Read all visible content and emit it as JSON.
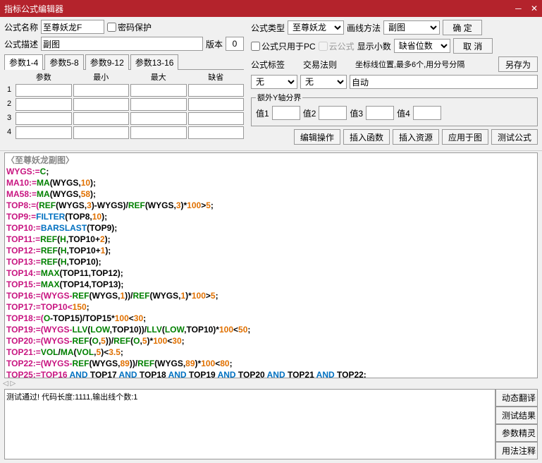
{
  "title": "指标公式编辑器",
  "window": {
    "min": "─",
    "close": "✕"
  },
  "labels": {
    "formulaName": "公式名称",
    "passwordProtect": "密码保护",
    "formulaDesc": "公式描述",
    "version": "版本",
    "formulaType": "公式类型",
    "drawMethod": "画线方法",
    "pcOnly": "公式只用于PC",
    "cloud": "云公式",
    "showDecimal": "显示小数",
    "decimalPlaces": "缺省位数",
    "formulaTag": "公式标签",
    "tradeRule": "交易法则",
    "coordHint": "坐标线位置,最多6个,用分号分隔",
    "extraY": "额外Y轴分界",
    "val1": "值1",
    "val2": "值2",
    "val3": "值3",
    "val4": "值4"
  },
  "values": {
    "formulaName": "至尊妖龙F",
    "formulaDesc": "副图",
    "version": "0",
    "formulaType": "至尊妖龙",
    "drawMethod": "副图",
    "decimalPlaces": "",
    "formulaTag": "无",
    "tradeRule": "无",
    "coord": "自动"
  },
  "buttons": {
    "ok": "确 定",
    "cancel": "取 消",
    "saveAs": "另存为",
    "editOp": "编辑操作",
    "insertFn": "插入函数",
    "insertRes": "插入资源",
    "applyChart": "应用于图",
    "testFormula": "测试公式",
    "dynTrans": "动态翻译",
    "testResult": "测试结果",
    "paramWizard": "参数精灵",
    "usageNote": "用法注释"
  },
  "paramTabs": [
    "参数1-4",
    "参数5-8",
    "参数9-12",
    "参数13-16"
  ],
  "paramHeaders": [
    "参数",
    "最小",
    "最大",
    "缺省"
  ],
  "paramRows": [
    "1",
    "2",
    "3",
    "4"
  ],
  "codeTitle": "〈至尊妖龙副图〉",
  "status": "测试通过! 代码长度:1111,输出线个数:1",
  "scrollIndicator": "◁ ▷",
  "code": [
    [
      [
        "WYGS:=",
        "k-pink"
      ],
      [
        "C",
        "k-green"
      ],
      [
        ";",
        ""
      ]
    ],
    [
      [
        "MA10:=",
        "k-pink"
      ],
      [
        "MA",
        "k-green"
      ],
      [
        "(WYGS,",
        ""
      ],
      [
        "10",
        "k-orange"
      ],
      [
        ");",
        ""
      ]
    ],
    [
      [
        "MA58:=",
        "k-pink"
      ],
      [
        "MA",
        "k-green"
      ],
      [
        "(WYGS,",
        ""
      ],
      [
        "58",
        "k-orange"
      ],
      [
        ");",
        ""
      ]
    ],
    [
      [
        "TOP8:=(",
        "k-pink"
      ],
      [
        "REF",
        "k-green"
      ],
      [
        "(WYGS,",
        ""
      ],
      [
        "3",
        "k-orange"
      ],
      [
        ")-WYGS)/",
        ""
      ],
      [
        "REF",
        "k-green"
      ],
      [
        "(WYGS,",
        ""
      ],
      [
        "3",
        "k-orange"
      ],
      [
        ")*",
        ""
      ],
      [
        "100",
        "k-orange"
      ],
      [
        ">",
        ""
      ],
      [
        "5",
        "k-orange"
      ],
      [
        ";",
        ""
      ]
    ],
    [
      [
        "TOP9:=",
        "k-pink"
      ],
      [
        "FILTER",
        "k-blue"
      ],
      [
        "(TOP8,",
        ""
      ],
      [
        "10",
        "k-orange"
      ],
      [
        ");",
        ""
      ]
    ],
    [
      [
        "TOP10:=",
        "k-pink"
      ],
      [
        "BARSLAST",
        "k-blue"
      ],
      [
        "(TOP9);",
        ""
      ]
    ],
    [
      [
        "TOP11:=",
        "k-pink"
      ],
      [
        "REF",
        "k-green"
      ],
      [
        "(",
        ""
      ],
      [
        "H",
        "k-green"
      ],
      [
        ",TOP10+",
        ""
      ],
      [
        "2",
        "k-orange"
      ],
      [
        ");",
        ""
      ]
    ],
    [
      [
        "TOP12:=",
        "k-pink"
      ],
      [
        "REF",
        "k-green"
      ],
      [
        "(",
        ""
      ],
      [
        "H",
        "k-green"
      ],
      [
        ",TOP10+",
        ""
      ],
      [
        "1",
        "k-orange"
      ],
      [
        ");",
        ""
      ]
    ],
    [
      [
        "TOP13:=",
        "k-pink"
      ],
      [
        "REF",
        "k-green"
      ],
      [
        "(",
        ""
      ],
      [
        "H",
        "k-green"
      ],
      [
        ",TOP10);",
        ""
      ]
    ],
    [
      [
        "TOP14:=",
        "k-pink"
      ],
      [
        "MAX",
        "k-green"
      ],
      [
        "(TOP11,TOP12);",
        ""
      ]
    ],
    [
      [
        "TOP15:=",
        "k-pink"
      ],
      [
        "MAX",
        "k-green"
      ],
      [
        "(TOP14,TOP13);",
        ""
      ]
    ],
    [
      [
        "TOP16:=(WYGS-",
        "k-pink"
      ],
      [
        "REF",
        "k-green"
      ],
      [
        "(WYGS,",
        ""
      ],
      [
        "1",
        "k-orange"
      ],
      [
        "))/",
        ""
      ],
      [
        "REF",
        "k-green"
      ],
      [
        "(WYGS,",
        ""
      ],
      [
        "1",
        "k-orange"
      ],
      [
        ")*",
        ""
      ],
      [
        "100",
        "k-orange"
      ],
      [
        ">",
        ""
      ],
      [
        "5",
        "k-orange"
      ],
      [
        ";",
        ""
      ]
    ],
    [
      [
        "TOP17:=TOP10<",
        "k-pink"
      ],
      [
        "150",
        "k-orange"
      ],
      [
        ";",
        ""
      ]
    ],
    [
      [
        "TOP18:=(",
        "k-pink"
      ],
      [
        "O",
        "k-green"
      ],
      [
        "-TOP15)/TOP15*",
        ""
      ],
      [
        "100",
        "k-orange"
      ],
      [
        "<",
        ""
      ],
      [
        "30",
        "k-orange"
      ],
      [
        ";",
        ""
      ]
    ],
    [
      [
        "TOP19:=(WYGS-",
        "k-pink"
      ],
      [
        "LLV",
        "k-green"
      ],
      [
        "(",
        ""
      ],
      [
        "LOW",
        "k-green"
      ],
      [
        ",TOP10))/",
        ""
      ],
      [
        "LLV",
        "k-green"
      ],
      [
        "(",
        ""
      ],
      [
        "LOW",
        "k-green"
      ],
      [
        ",TOP10)*",
        ""
      ],
      [
        "100",
        "k-orange"
      ],
      [
        "<",
        ""
      ],
      [
        "50",
        "k-orange"
      ],
      [
        ";",
        ""
      ]
    ],
    [
      [
        "TOP20:=(WYGS-",
        "k-pink"
      ],
      [
        "REF",
        "k-green"
      ],
      [
        "(",
        ""
      ],
      [
        "O",
        "k-green"
      ],
      [
        ",",
        ""
      ],
      [
        "5",
        "k-orange"
      ],
      [
        "))/",
        ""
      ],
      [
        "REF",
        "k-green"
      ],
      [
        "(",
        ""
      ],
      [
        "O",
        "k-green"
      ],
      [
        ",",
        ""
      ],
      [
        "5",
        "k-orange"
      ],
      [
        ")*",
        ""
      ],
      [
        "100",
        "k-orange"
      ],
      [
        "<",
        ""
      ],
      [
        "30",
        "k-orange"
      ],
      [
        ";",
        ""
      ]
    ],
    [
      [
        "TOP21:=",
        "k-pink"
      ],
      [
        "VOL",
        "k-green"
      ],
      [
        "/",
        ""
      ],
      [
        "MA",
        "k-green"
      ],
      [
        "(",
        ""
      ],
      [
        "VOL",
        "k-green"
      ],
      [
        ",",
        ""
      ],
      [
        "5",
        "k-orange"
      ],
      [
        ")<",
        ""
      ],
      [
        "3.5",
        "k-orange"
      ],
      [
        ";",
        ""
      ]
    ],
    [
      [
        "TOP22:=(WYGS-",
        "k-pink"
      ],
      [
        "REF",
        "k-green"
      ],
      [
        "(WYGS,",
        ""
      ],
      [
        "89",
        "k-orange"
      ],
      [
        "))/",
        ""
      ],
      [
        "REF",
        "k-green"
      ],
      [
        "(WYGS,",
        ""
      ],
      [
        "89",
        "k-orange"
      ],
      [
        ")*",
        ""
      ],
      [
        "100",
        "k-orange"
      ],
      [
        "<",
        ""
      ],
      [
        "80",
        "k-orange"
      ],
      [
        ";",
        ""
      ]
    ],
    [
      [
        "TOP25:=TOP16 ",
        "k-pink"
      ],
      [
        "AND",
        "k-blue"
      ],
      [
        " TOP17 ",
        ""
      ],
      [
        "AND",
        "k-blue"
      ],
      [
        " TOP18 ",
        ""
      ],
      [
        "AND",
        "k-blue"
      ],
      [
        " TOP19 ",
        ""
      ],
      [
        "AND",
        "k-blue"
      ],
      [
        " TOP20 ",
        ""
      ],
      [
        "AND",
        "k-blue"
      ],
      [
        " TOP21 ",
        ""
      ],
      [
        "AND",
        "k-blue"
      ],
      [
        " TOP22:",
        ""
      ]
    ]
  ]
}
